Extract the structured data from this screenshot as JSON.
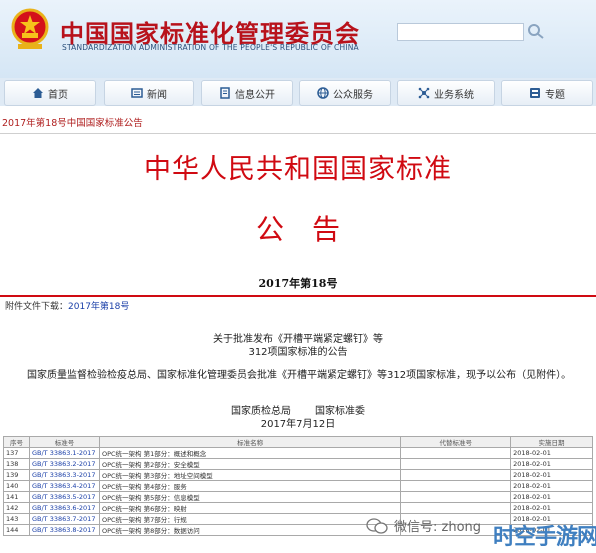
{
  "header": {
    "title": "中国国家标准化管理委员会",
    "subtitle": "STANDARDIZATION ADMINISTRATION OF THE PEOPLE'S REPUBLIC OF CHINA"
  },
  "nav": {
    "items": [
      {
        "label": "首页",
        "icon": "home-icon"
      },
      {
        "label": "新闻",
        "icon": "news-icon"
      },
      {
        "label": "信息公开",
        "icon": "document-icon"
      },
      {
        "label": "公众服务",
        "icon": "globe-icon"
      },
      {
        "label": "业务系统",
        "icon": "network-icon"
      },
      {
        "label": "专题",
        "icon": "topic-icon"
      }
    ]
  },
  "breadcrumb": "2017年第18号中国国家标准公告",
  "article": {
    "main_title": "中华人民共和国国家标准",
    "announcement": "公告",
    "doc_number": "2017年第18号",
    "attachment_label": "附件文件下载：",
    "attachment_link": "2017年第18号",
    "notice_title_line1": "关于批准发布《开槽平端紧定螺钉》等",
    "notice_title_line2": "312项国家标准的公告",
    "body": "国家质量监督检验检疫总局、国家标准化管理委员会批准《开槽平端紧定螺钉》等312项国家标准，现予以公布（见附件）。",
    "signer_1": "国家质检总局",
    "signer_2": "国家标准委",
    "date": "2017年7月12日"
  },
  "table": {
    "headers": [
      "序号",
      "标准号",
      "标准名称",
      "代替标准号",
      "实施日期"
    ],
    "rows": [
      {
        "no": "137",
        "code": "GB/T 33863.1-2017",
        "name": "OPC统一架构 第1部分：概述和概念",
        "replace": "",
        "date": "2018-02-01"
      },
      {
        "no": "138",
        "code": "GB/T 33863.2-2017",
        "name": "OPC统一架构 第2部分：安全模型",
        "replace": "",
        "date": "2018-02-01"
      },
      {
        "no": "139",
        "code": "GB/T 33863.3-2017",
        "name": "OPC统一架构 第3部分：地址空间模型",
        "replace": "",
        "date": "2018-02-01"
      },
      {
        "no": "140",
        "code": "GB/T 33863.4-2017",
        "name": "OPC统一架构 第4部分：服务",
        "replace": "",
        "date": "2018-02-01"
      },
      {
        "no": "141",
        "code": "GB/T 33863.5-2017",
        "name": "OPC统一架构 第5部分：信息模型",
        "replace": "",
        "date": "2018-02-01"
      },
      {
        "no": "142",
        "code": "GB/T 33863.6-2017",
        "name": "OPC统一架构 第6部分：映射",
        "replace": "",
        "date": "2018-02-01"
      },
      {
        "no": "143",
        "code": "GB/T 33863.7-2017",
        "name": "OPC统一架构 第7部分：行规",
        "replace": "",
        "date": "2018-02-01"
      },
      {
        "no": "144",
        "code": "GB/T 33863.8-2017",
        "name": "OPC统一架构 第8部分：数据访问",
        "replace": "",
        "date": "2018-02-01"
      }
    ]
  },
  "watermark": {
    "text": "微信号: zhong",
    "logo": "时空手游网"
  },
  "colors": {
    "brand_red": "#d00a12",
    "link_blue": "#1a3fa8",
    "header_blue": "#d5e6f5"
  }
}
